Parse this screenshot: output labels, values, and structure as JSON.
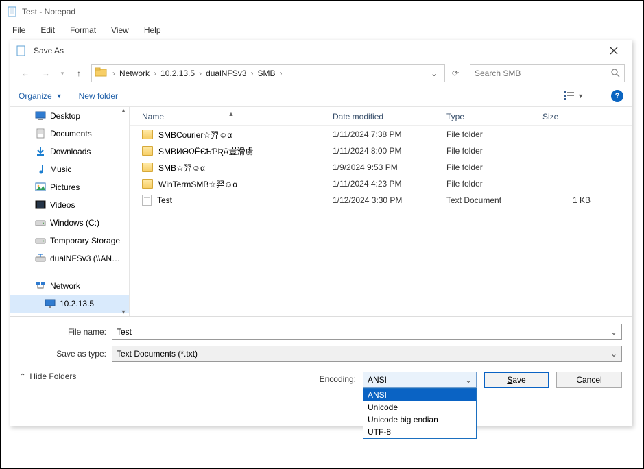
{
  "window": {
    "title": "Test - Notepad"
  },
  "menubar": [
    "File",
    "Edit",
    "Format",
    "View",
    "Help"
  ],
  "dialog": {
    "title": "Save As",
    "breadcrumb": [
      "Network",
      "10.2.13.5",
      "dualNFSv3",
      "SMB"
    ],
    "search_placeholder": "Search SMB",
    "organize_label": "Organize",
    "newfolder_label": "New folder",
    "sidebar": [
      {
        "icon": "desktop",
        "label": "Desktop"
      },
      {
        "icon": "document",
        "label": "Documents"
      },
      {
        "icon": "download",
        "label": "Downloads"
      },
      {
        "icon": "music",
        "label": "Music"
      },
      {
        "icon": "pictures",
        "label": "Pictures"
      },
      {
        "icon": "videos",
        "label": "Videos"
      },
      {
        "icon": "disk",
        "label": "Windows (C:)"
      },
      {
        "icon": "disk",
        "label": "Temporary Storage"
      },
      {
        "icon": "netdisk",
        "label": "dualNFSv3 (\\\\AN…"
      },
      {
        "icon": "spacer",
        "label": ""
      },
      {
        "icon": "network",
        "label": "Network"
      },
      {
        "icon": "monitor",
        "label": "10.2.13.5",
        "selected": true,
        "sub": true
      }
    ],
    "columns": {
      "name": "Name",
      "date": "Date modified",
      "type": "Type",
      "size": "Size"
    },
    "files": [
      {
        "kind": "folder",
        "name": "SMBCourier☆羿☺α",
        "date": "1/11/2024 7:38 PM",
        "type": "File folder",
        "size": ""
      },
      {
        "kind": "folder",
        "name": "SMBИΘΩËЄҌƤƦӝ豈滑虜",
        "date": "1/11/2024 8:00 PM",
        "type": "File folder",
        "size": ""
      },
      {
        "kind": "folder",
        "name": "SMB☆羿☺α",
        "date": "1/9/2024 9:53 PM",
        "type": "File folder",
        "size": ""
      },
      {
        "kind": "folder",
        "name": "WinTermSMB☆羿☺α",
        "date": "1/11/2024 4:23 PM",
        "type": "File folder",
        "size": ""
      },
      {
        "kind": "file",
        "name": "Test",
        "date": "1/12/2024 3:30 PM",
        "type": "Text Document",
        "size": "1 KB"
      }
    ],
    "filename_label": "File name:",
    "filename_value": "Test",
    "saveastype_label": "Save as type:",
    "saveastype_value": "Text Documents (*.txt)",
    "hidefolders_label": "Hide Folders",
    "encoding_label": "Encoding:",
    "encoding_selected": "ANSI",
    "encoding_options": [
      "ANSI",
      "Unicode",
      "Unicode big endian",
      "UTF-8"
    ],
    "save_label": "Save",
    "cancel_label": "Cancel"
  }
}
